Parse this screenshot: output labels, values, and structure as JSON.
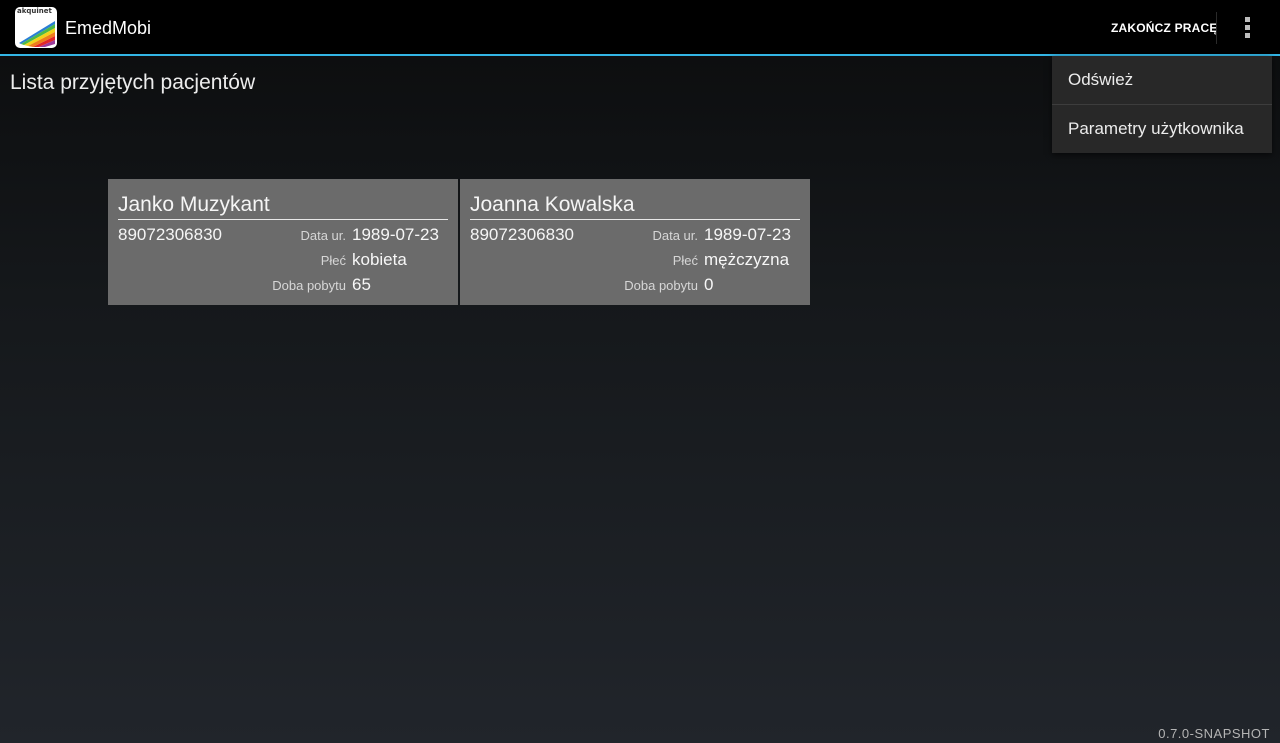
{
  "actionbar": {
    "app_title": "EmedMobi",
    "app_icon": "emedmobi-logo-icon",
    "app_icon_text": "akquinet",
    "action_label": "ZAKOŃCZ PRACĘ",
    "overflow_icon": "overflow-menu-icon",
    "divider_color": "#33b5e5"
  },
  "page": {
    "title": "Lista przyjętych pacjentów"
  },
  "patients": [
    {
      "name": "Janko Muzykant",
      "pesel": "89072306830",
      "birth_label": "Data ur.",
      "birth_date": "1989-07-23",
      "sex_label": "Płeć",
      "sex": "kobieta",
      "stay_label": "Doba pobytu",
      "stay_day": "65"
    },
    {
      "name": "Joanna Kowalska",
      "pesel": "89072306830",
      "birth_label": "Data ur.",
      "birth_date": "1989-07-23",
      "sex_label": "Płeć",
      "sex": "mężczyzna",
      "stay_label": "Doba pobytu",
      "stay_day": "0"
    }
  ],
  "overflow_menu": {
    "items": [
      {
        "label": "Odśwież"
      },
      {
        "label": "Parametry użytkownika"
      }
    ]
  },
  "footer": {
    "version": "0.7.0-SNAPSHOT"
  }
}
